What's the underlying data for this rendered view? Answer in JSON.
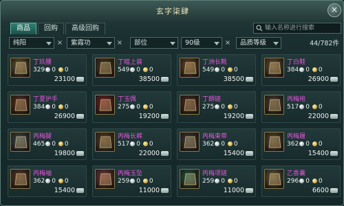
{
  "window": {
    "title": "玄字柒肆",
    "close_label": "×"
  },
  "tabs": [
    {
      "label": "商品",
      "active": true
    },
    {
      "label": "回购",
      "active": false
    },
    {
      "label": "高级回购",
      "active": false
    }
  ],
  "search": {
    "placeholder": "输入名称进行搜索"
  },
  "filters": {
    "faction": "纯阳",
    "skill": "紫霞功",
    "slot": "部位",
    "level": "90级",
    "quality": "品质等级",
    "count": "44/782件",
    "clear": "×"
  },
  "items": [
    {
      "name": "丁玖腰",
      "qty": "329",
      "silver": "0",
      "gold": "0",
      "price": "23100",
      "icon": "belt-icon",
      "color": "#6b5a3a"
    },
    {
      "name": "丁暗上装",
      "qty": "549",
      "silver": "0",
      "gold": "0",
      "price": "38500",
      "icon": "chest-armor-icon",
      "color": "#4a3a26"
    },
    {
      "name": "丁洲长靴",
      "qty": "549",
      "silver": "0",
      "gold": "0",
      "price": "38500",
      "icon": "pants-icon",
      "color": "#6b4a2a"
    },
    {
      "name": "丁白鞋",
      "qty": "384",
      "silver": "0",
      "gold": "0",
      "price": "26900",
      "icon": "boots-icon",
      "color": "#6a5433"
    },
    {
      "name": "丁夏护手",
      "qty": "384",
      "silver": "0",
      "gold": "0",
      "price": "26900",
      "icon": "bracer-icon",
      "color": "#5b2f22"
    },
    {
      "name": "丁玉佩",
      "qty": "275",
      "silver": "0",
      "gold": "0",
      "price": "19200",
      "icon": "pendant-icon",
      "color": "#7a2222"
    },
    {
      "name": "丁朗链",
      "qty": "275",
      "silver": "0",
      "gold": "0",
      "price": "19200",
      "icon": "necklace-icon",
      "color": "#4d2a20"
    },
    {
      "name": "丙梅袍",
      "qty": "517",
      "silver": "0",
      "gold": "0",
      "price": "22000",
      "icon": "robe-icon",
      "color": "#4c3f2f"
    },
    {
      "name": "丙梅腿",
      "qty": "465",
      "silver": "0",
      "gold": "0",
      "price": "19800",
      "icon": "leggings-icon",
      "color": "#3a4a55"
    },
    {
      "name": "丙梅长裤",
      "qty": "517",
      "silver": "0",
      "gold": "0",
      "price": "22000",
      "icon": "trousers-icon",
      "color": "#5a4328"
    },
    {
      "name": "丙梅束带",
      "qty": "362",
      "silver": "0",
      "gold": "0",
      "price": "15400",
      "icon": "sash-icon",
      "color": "#3a3a3a"
    },
    {
      "name": "丙梅履",
      "qty": "362",
      "silver": "0",
      "gold": "0",
      "price": "15400",
      "icon": "shoes-icon",
      "color": "#5a4a32"
    },
    {
      "name": "丙梅袖",
      "qty": "362",
      "silver": "0",
      "gold": "0",
      "price": "15400",
      "icon": "sleeve-icon",
      "color": "#5b3a2a"
    },
    {
      "name": "丙梅玉坠",
      "qty": "259",
      "silver": "0",
      "gold": "0",
      "price": "11000",
      "icon": "jade-pendant-icon",
      "color": "#7a3a3a"
    },
    {
      "name": "丙梅项链",
      "qty": "259",
      "silver": "0",
      "gold": "0",
      "price": "11000",
      "icon": "jade-necklace-icon",
      "color": "#1d5a44"
    },
    {
      "name": "乙香囊",
      "qty": "296",
      "silver": "0",
      "gold": "0",
      "price": "6600",
      "icon": "sachet-icon",
      "color": "#6a5a3a"
    }
  ]
}
